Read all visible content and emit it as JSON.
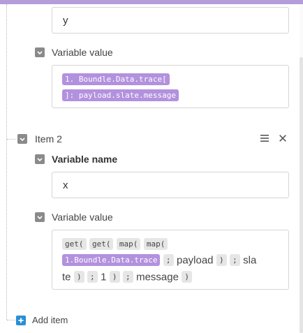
{
  "item1": {
    "name_value": "y",
    "value_label": "Variable value",
    "value_pills": [
      "1. Boundle.Data.trace[",
      "]: payload.slate.message"
    ]
  },
  "item2": {
    "title": "Item 2",
    "name_label": "Variable name",
    "name_value": "x",
    "value_label": "Variable value",
    "line1": [
      "get(",
      "get(",
      "map(",
      "map("
    ],
    "line2_pill": "1.Boundle.Data.trace",
    "line2_sep": ";",
    "line2_text": "payload",
    "line2_close": ")",
    "line2_sep2": ";",
    "line2_text2": "sla",
    "line3_text": "te",
    "line3_close": ")",
    "line3_sep": ";",
    "line3_num": "1",
    "line3_close2": ")",
    "line3_sep2": ";",
    "line3_text2": "message",
    "line3_close3": ")"
  },
  "footer": {
    "add_item": "Add item"
  },
  "icons": {
    "checkbox": "check-icon",
    "menu": "hamburger-icon",
    "close": "close-icon",
    "add": "plus-icon"
  },
  "colors": {
    "accent_bar": "#b39ddb",
    "pill_purple": "#b291de",
    "add_button": "#2a8fd4"
  }
}
